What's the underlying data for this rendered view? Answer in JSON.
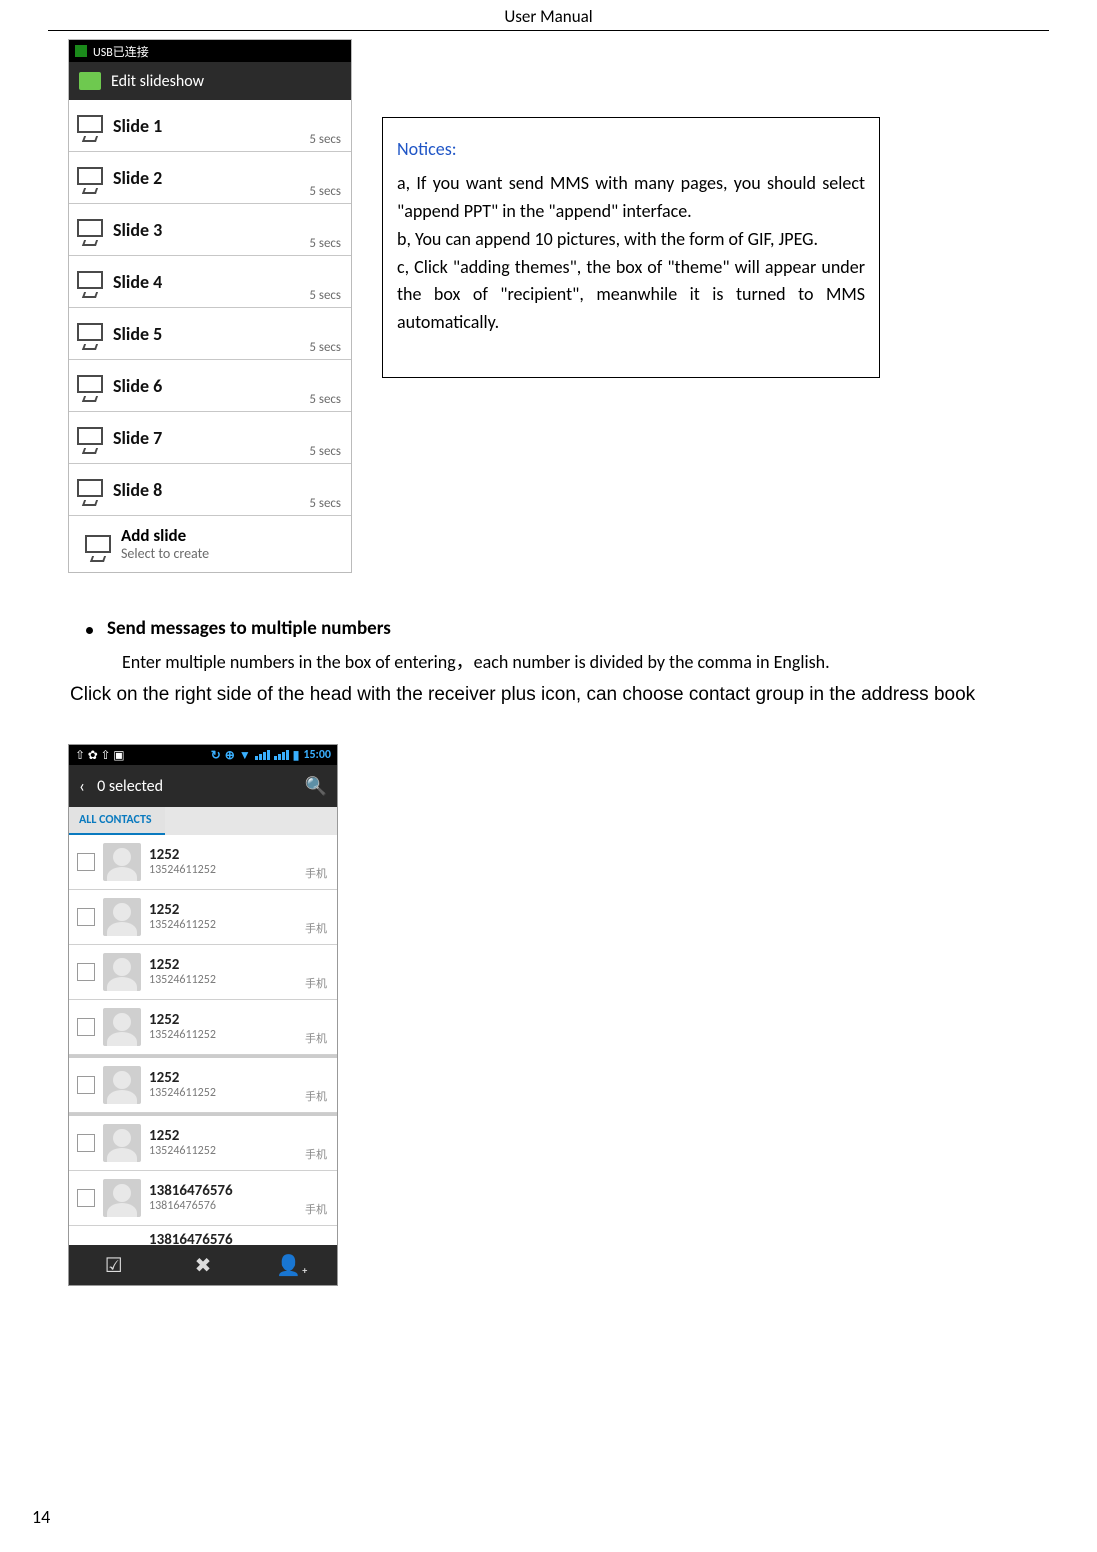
{
  "header": {
    "title": "User   Manual"
  },
  "page_number": "14",
  "phone1": {
    "usb_label": "USB已连接",
    "edit_title": "Edit slideshow",
    "slides": [
      {
        "title": "Slide 1",
        "duration": "5 secs"
      },
      {
        "title": "Slide 2",
        "duration": "5 secs"
      },
      {
        "title": "Slide 3",
        "duration": "5 secs"
      },
      {
        "title": "Slide 4",
        "duration": "5 secs"
      },
      {
        "title": "Slide 5",
        "duration": "5 secs"
      },
      {
        "title": "Slide 6",
        "duration": "5 secs"
      },
      {
        "title": "Slide 7",
        "duration": "5 secs"
      },
      {
        "title": "Slide 8",
        "duration": "5 secs"
      }
    ],
    "add_title": "Add slide",
    "add_subtitle": "Select to create"
  },
  "notices": {
    "title": "Notices:",
    "a": "a, If you want send MMS with many pages, you should select \"append PPT\" in the \"append\" interface.",
    "b": "b, You can append 10 pictures, with the form of GIF, JPEG.",
    "c": "c, Click \"adding themes\", the box of \"theme\" will appear under the box of \"recipient\", meanwhile it is turned to MMS automatically."
  },
  "section": {
    "bullet_title": "Send messages to multiple numbers",
    "line1": "Enter multiple numbers in the box of entering，each number is divided by the comma in English.",
    "line2": "Click on the right side of the head with the receiver plus icon, can choose contact group in the address book"
  },
  "phone2": {
    "time": "15:00",
    "selected_label": "0 selected",
    "tab": "ALL CONTACTS",
    "type_label": "手机",
    "contacts": [
      {
        "name": "1252",
        "number": "13524611252"
      },
      {
        "name": "1252",
        "number": "13524611252"
      },
      {
        "name": "1252",
        "number": "13524611252"
      },
      {
        "name": "1252",
        "number": "13524611252"
      },
      {
        "name": "1252",
        "number": "13524611252"
      },
      {
        "name": "1252",
        "number": "13524611252"
      },
      {
        "name": "13816476576",
        "number": "13816476576"
      }
    ],
    "partial": {
      "name": "13816476576"
    }
  }
}
